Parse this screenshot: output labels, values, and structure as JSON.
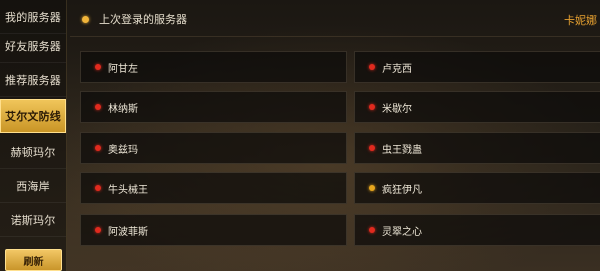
{
  "sidebar": {
    "items": [
      {
        "label": "我的服务器"
      },
      {
        "label": "好友服务器"
      },
      {
        "label": "推荐服务器"
      },
      {
        "label": "艾尔文防线",
        "active": true
      },
      {
        "label": "赫顿玛尔"
      },
      {
        "label": "西海岸"
      },
      {
        "label": "诺斯玛尔"
      }
    ],
    "refresh_label": "刷新"
  },
  "header": {
    "title": "上次登录的服务器",
    "right_text": "卡妮娜"
  },
  "status_colors": {
    "red": "#e02a1e",
    "amber": "#e6a61e",
    "accent": "#f0b43a"
  },
  "servers": [
    {
      "name": "阿甘左",
      "status": "red"
    },
    {
      "name": "卢克西",
      "status": "red"
    },
    {
      "name": "林纳斯",
      "status": "red"
    },
    {
      "name": "米歇尔",
      "status": "red"
    },
    {
      "name": "奥兹玛",
      "status": "red"
    },
    {
      "name": "虫王戮蛊",
      "status": "red"
    },
    {
      "name": "牛头械王",
      "status": "red"
    },
    {
      "name": "疯狂伊凡",
      "status": "amber"
    },
    {
      "name": "阿波菲斯",
      "status": "red"
    },
    {
      "name": "灵翠之心",
      "status": "red"
    }
  ]
}
